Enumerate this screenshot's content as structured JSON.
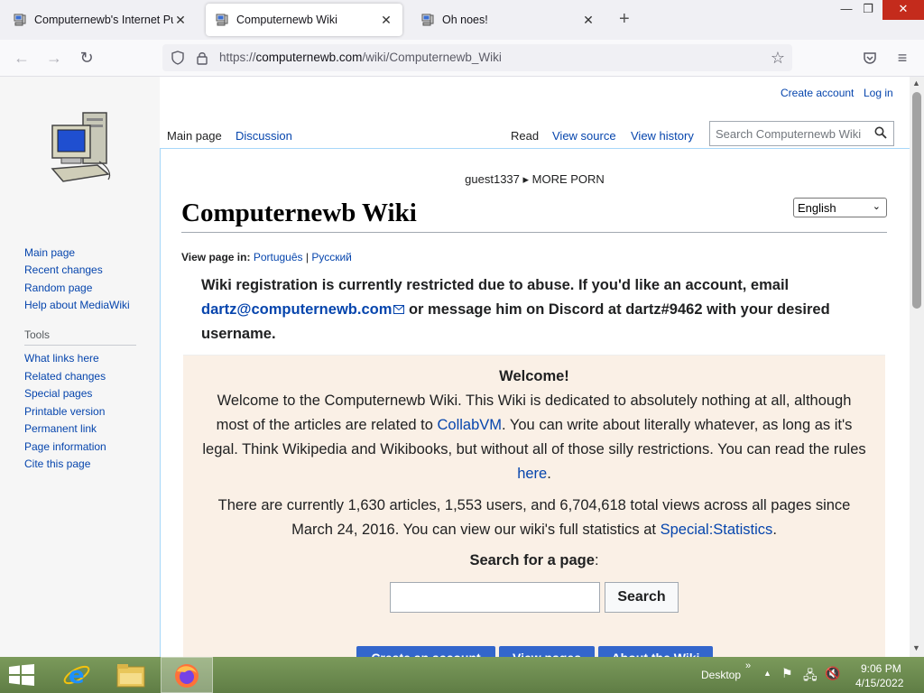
{
  "browser": {
    "tabs": [
      {
        "title": "Computernewb's Internet Pub",
        "active": false
      },
      {
        "title": "Computernewb Wiki",
        "active": true
      },
      {
        "title": "Oh noes!",
        "active": false
      }
    ],
    "url_prefix": "https://",
    "url_host": "computernewb.com",
    "url_path": "/wiki/Computernewb_Wiki",
    "window_controls": [
      "minimize",
      "restore",
      "close"
    ]
  },
  "wiki": {
    "personal": {
      "create_account": "Create account",
      "log_in": "Log in"
    },
    "left_tabs": [
      {
        "label": "Main page",
        "selected": true
      },
      {
        "label": "Discussion",
        "selected": false
      }
    ],
    "right_tabs": [
      {
        "label": "Read",
        "selected": true
      },
      {
        "label": "View source",
        "selected": false
      },
      {
        "label": "View history",
        "selected": false
      }
    ],
    "search_placeholder": "Search Computernewb Wiki",
    "sidebar": {
      "nav": [
        "Main page",
        "Recent changes",
        "Random page",
        "Help about MediaWiki"
      ],
      "tools_heading": "Tools",
      "tools": [
        "What links here",
        "Related changes",
        "Special pages",
        "Printable version",
        "Permanent link",
        "Page information",
        "Cite this page"
      ]
    },
    "site_notice": "guest1337 ▸ MORE PORN",
    "heading": "Computernewb Wiki",
    "language_selected": "English",
    "view_in": {
      "label": "View page in:",
      "lang1": "Português",
      "sep": "|",
      "lang2": "Русский"
    },
    "notice": {
      "part1": "Wiki registration is currently restricted due to abuse. If you'd like an account, email ",
      "email": "dartz@computernewb.com",
      "part2": " or message him on Discord at dartz#9462 with your desired username."
    },
    "welcome": {
      "title": "Welcome!",
      "p1a": "Welcome to the Computernewb Wiki. This Wiki is dedicated to absolutely nothing at all, although most of the articles are related to ",
      "p1_link1": "CollabVM",
      "p1b": ". You can write about literally whatever, as long as it's legal. Think Wikipedia and Wikibooks, but without all of those silly restrictions. You can read the rules ",
      "p1_link2": "here",
      "p1c": ".",
      "p2a": "There are currently 1,630 articles, 1,553 users, and 6,704,618 total views across all pages since March 24, 2016. You can view our wiki's full statistics at ",
      "p2_link": "Special:Statistics",
      "p2b": ".",
      "search_label": "Search for a page",
      "search_colon": ":",
      "search_button": "Search",
      "buttons": [
        "Create an account",
        "View pages",
        "About the Wiki"
      ]
    }
  },
  "taskbar": {
    "desktop_label": "Desktop",
    "time": "9:06 PM",
    "date": "4/15/2022"
  }
}
